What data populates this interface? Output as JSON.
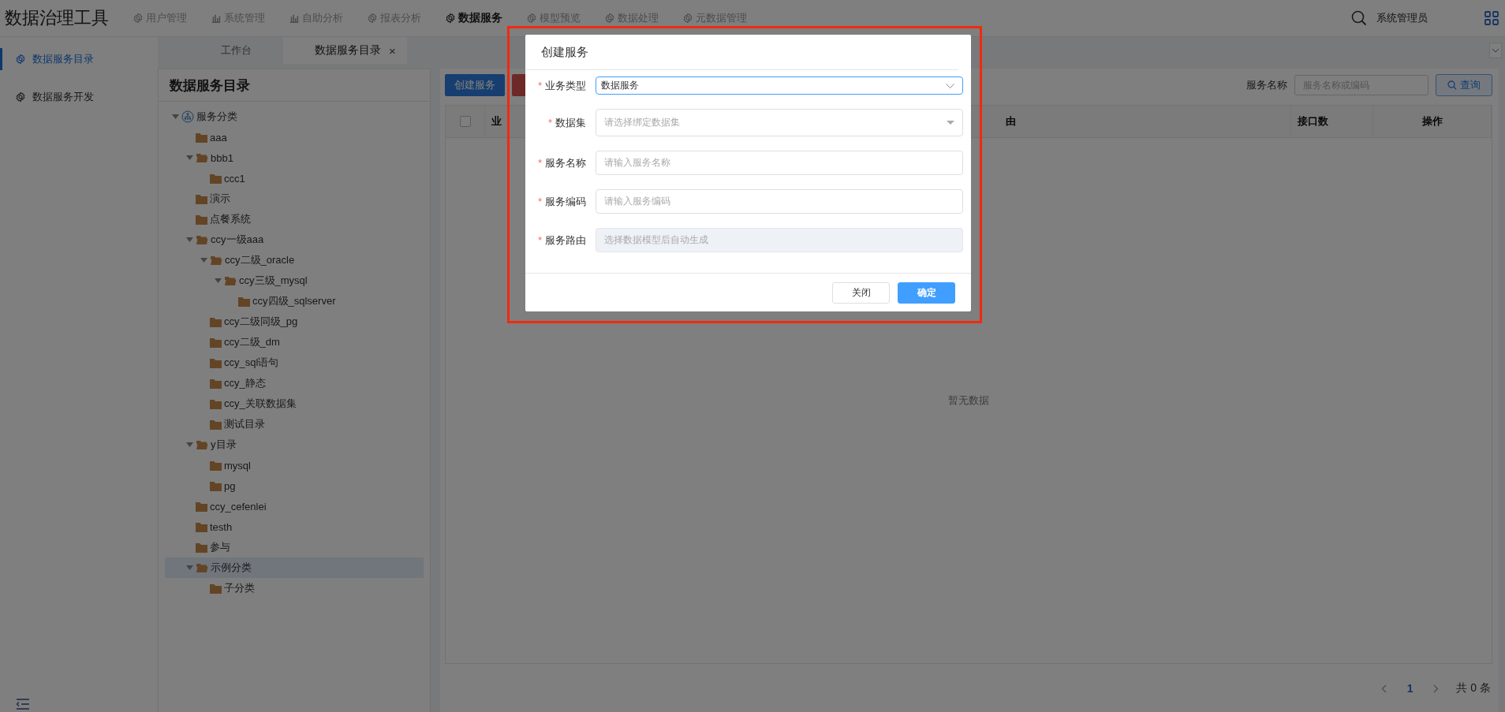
{
  "app": {
    "title": "数据治理工具"
  },
  "nav": [
    {
      "label": "用户管理",
      "kind": "gear",
      "selected": false
    },
    {
      "label": "系统管理",
      "kind": "chart",
      "selected": false
    },
    {
      "label": "自助分析",
      "kind": "chart",
      "selected": false
    },
    {
      "label": "报表分析",
      "kind": "gear",
      "selected": false
    },
    {
      "label": "数据服务",
      "kind": "gear",
      "selected": true
    },
    {
      "label": "模型预览",
      "kind": "gear",
      "selected": false
    },
    {
      "label": "数据处理",
      "kind": "gear",
      "selected": false
    },
    {
      "label": "元数据管理",
      "kind": "gear",
      "selected": false
    }
  ],
  "user": {
    "name": "系统管理员"
  },
  "tabs": [
    {
      "label": "工作台",
      "selected": false
    },
    {
      "label": "数据服务目录",
      "selected": true,
      "close": "×"
    }
  ],
  "sidebar": {
    "items": [
      {
        "label": "数据服务目录",
        "selected": true
      },
      {
        "label": "数据服务开发",
        "selected": false
      }
    ]
  },
  "tree": {
    "title": "数据服务目录",
    "nodes": [
      {
        "label": "服务分类",
        "kind": "root",
        "expanded": true,
        "selected": false,
        "children": [
          {
            "label": "aaa",
            "kind": "folder",
            "selected": false
          },
          {
            "label": "bbb1",
            "kind": "folder",
            "expanded": true,
            "selected": false,
            "children": [
              {
                "label": "ccc1",
                "kind": "folder",
                "selected": false
              }
            ]
          },
          {
            "label": "演示",
            "kind": "folder",
            "selected": false
          },
          {
            "label": "点餐系统",
            "kind": "folder",
            "selected": false
          },
          {
            "label": "ccy一级aaa",
            "kind": "folder",
            "expanded": true,
            "selected": false,
            "children": [
              {
                "label": "ccy二级_oracle",
                "kind": "folder",
                "expanded": true,
                "selected": false,
                "children": [
                  {
                    "label": "ccy三级_mysql",
                    "kind": "folder",
                    "expanded": true,
                    "selected": false,
                    "children": [
                      {
                        "label": "ccy四级_sqlserver",
                        "kind": "folder",
                        "selected": false
                      }
                    ]
                  }
                ]
              },
              {
                "label": "ccy二级同级_pg",
                "kind": "folder",
                "selected": false
              },
              {
                "label": "ccy二级_dm",
                "kind": "folder",
                "selected": false
              },
              {
                "label": "ccy_sql语句",
                "kind": "folder",
                "selected": false
              },
              {
                "label": "ccy_静态",
                "kind": "folder",
                "selected": false
              },
              {
                "label": "ccy_关联数据集",
                "kind": "folder",
                "selected": false
              },
              {
                "label": "测试目录",
                "kind": "folder",
                "selected": false
              }
            ]
          },
          {
            "label": "y目录",
            "kind": "folder",
            "expanded": true,
            "selected": false,
            "children": [
              {
                "label": "mysql",
                "kind": "folder",
                "selected": false
              },
              {
                "label": "pg",
                "kind": "folder",
                "selected": false
              }
            ]
          },
          {
            "label": "ccy_cefenlei",
            "kind": "folder",
            "selected": false
          },
          {
            "label": "testh",
            "kind": "folder",
            "selected": false
          },
          {
            "label": "参与",
            "kind": "folder",
            "selected": false
          },
          {
            "label": "示例分类",
            "kind": "folder",
            "expanded": true,
            "selected": true,
            "children": [
              {
                "label": "子分类",
                "kind": "folder",
                "selected": false
              }
            ]
          }
        ]
      }
    ]
  },
  "toolbar": {
    "buttons": [
      {
        "label": "创建服务",
        "kind": "primary"
      },
      {
        "kind": "danger"
      }
    ],
    "search_label": "服务名称",
    "search": {
      "placeholder": "服务名称或编码"
    },
    "query_button": "查询"
  },
  "table": {
    "select_all": {
      "checked": false
    },
    "columns": [
      "业",
      "由",
      "接口数",
      "操作"
    ],
    "empty_text": "暂无数据"
  },
  "pagination": {
    "pages": [
      {
        "label": "1",
        "selected": true
      }
    ],
    "total": "共 0 条"
  },
  "dialog": {
    "title": "创建服务",
    "fields": [
      {
        "mark": "*",
        "label": "业务类型",
        "kind": "select",
        "value": "数据服务",
        "focused": true
      },
      {
        "mark": "*",
        "label": "数据集",
        "kind": "dropdown",
        "placeholder": "请选择绑定数据集",
        "focused": false
      },
      {
        "mark": "*",
        "label": "服务名称",
        "kind": "input",
        "placeholder": "请输入服务名称",
        "focused": false
      },
      {
        "mark": "*",
        "label": "服务编码",
        "kind": "input",
        "placeholder": "请输入服务编码",
        "focused": false
      },
      {
        "mark": "*",
        "label": "服务路由",
        "kind": "input",
        "placeholder": "选择数据模型后自动生成",
        "focused": false,
        "disabled": true
      }
    ],
    "buttons": [
      {
        "label": "关闭",
        "kind": "default"
      },
      {
        "label": "确定",
        "kind": "primary"
      }
    ]
  }
}
